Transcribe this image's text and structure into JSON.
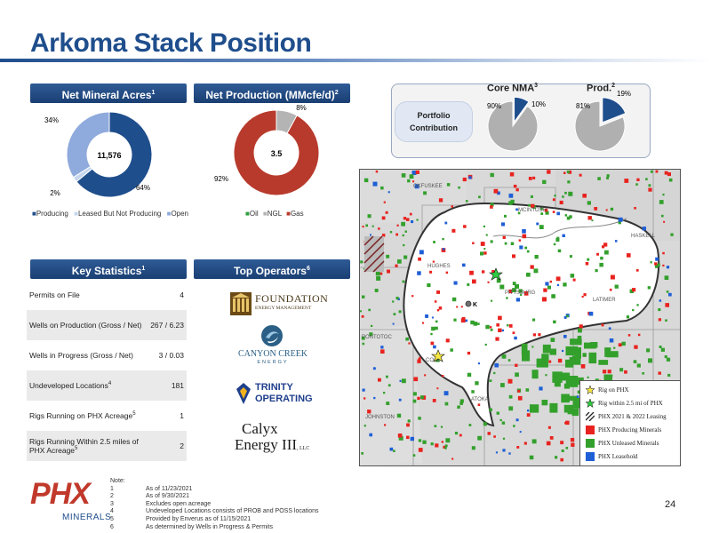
{
  "page": {
    "title": "Arkoma Stack Position",
    "page_number": "24"
  },
  "colors": {
    "brand_blue": "#1f4e8c",
    "producing": "#1f4e8c",
    "leased_not_producing": "#c5d6ee",
    "open": "#8faadc",
    "oil": "#2e9e3e",
    "ngl": "#b4b4b4",
    "gas": "#b83a2c",
    "pie_gray": "#b0b0b0",
    "phx_red": "#c0392b"
  },
  "net_mineral_acres": {
    "header": "Net Mineral Acres",
    "header_sup": "1",
    "center_value": "11,576",
    "labels": {
      "open_pct": "34%",
      "leased_pct": "2%",
      "producing_pct": "64%"
    },
    "legend": [
      "Producing",
      "Leased But Not Producing",
      "Open"
    ]
  },
  "net_production": {
    "header": "Net Production (MMcfe/d)",
    "header_sup": "2",
    "center_value": "3.5",
    "labels": {
      "ngl_pct": "8%",
      "gas_pct": "92%"
    },
    "legend": [
      "Oil",
      "NGL",
      "Gas"
    ]
  },
  "chart_data": [
    {
      "type": "pie",
      "title": "Net Mineral Acres",
      "categories": [
        "Producing",
        "Leased But Not Producing",
        "Open"
      ],
      "values": [
        64,
        2,
        34
      ],
      "center_label": "11,576"
    },
    {
      "type": "pie",
      "title": "Net Production (MMcfe/d)",
      "categories": [
        "Oil",
        "NGL",
        "Gas"
      ],
      "values": [
        0,
        8,
        92
      ],
      "center_label": "3.5"
    },
    {
      "type": "pie",
      "title": "Core NMA",
      "categories": [
        "Core NMA",
        "Other"
      ],
      "values": [
        10,
        90
      ]
    },
    {
      "type": "pie",
      "title": "Prod.",
      "categories": [
        "Prod.",
        "Other"
      ],
      "values": [
        19,
        81
      ]
    }
  ],
  "portfolio": {
    "label_line1": "Portfolio",
    "label_line2": "Contribution",
    "core_title": "Core NMA",
    "core_sup": "3",
    "core_small": "10%",
    "core_large": "90%",
    "prod_title": "Prod.",
    "prod_sup": "2",
    "prod_small": "19%",
    "prod_large": "81%"
  },
  "key_statistics": {
    "header": "Key Statistics",
    "header_sup": "1",
    "rows": [
      {
        "label": "Permits on File",
        "sup": "",
        "value": "4"
      },
      {
        "label": "Wells on Production (Gross / Net)",
        "sup": "",
        "value": "267 / 6.23"
      },
      {
        "label": "Wells in Progress  (Gross / Net)",
        "sup": "",
        "value": "3 / 0.03"
      },
      {
        "label": "Undeveloped Locations",
        "sup": "4",
        "value": "181"
      },
      {
        "label": "Rigs Running on PHX Acreage",
        "sup": "5",
        "value": "1"
      },
      {
        "label": "Rigs Running Within 2.5 miles of PHX Acreage",
        "sup": "5",
        "value": "2"
      }
    ]
  },
  "top_operators": {
    "header": "Top Operators",
    "header_sup": "6",
    "foundation_main": "FOUNDATION",
    "foundation_sub": "ENERGY MANAGEMENT",
    "canyon_main": "CANYON CREEK",
    "canyon_sub": "ENERGY",
    "trinity_line1": "TRINITY",
    "trinity_line2": "OPERATING",
    "calyx_line1": "Calyx",
    "calyx_line2": "Energy III",
    "calyx_suffix": ", LLC"
  },
  "map": {
    "counties": [
      "MCINTOSH",
      "HASKELL",
      "HUGHES",
      "PITTSBURG",
      "COAL",
      "ATOKA",
      "JOHNSTON",
      "OKFUSKEE",
      "PONTOTOC",
      "LATIMER"
    ],
    "marker_label": "K",
    "legend": [
      {
        "label": "Rig on PHX",
        "color": "#f5e642"
      },
      {
        "label": "Rig within 2.5 mi of PHX",
        "color": "#2ecc40"
      },
      {
        "label": "PHX 2021 & 2022 Leasing",
        "color": "hatch"
      },
      {
        "label": "PHX Producing Minerals",
        "color": "#e8231f"
      },
      {
        "label": "PHX Unleased Minerals",
        "color": "#33a02c"
      },
      {
        "label": "PHX Leasehold",
        "color": "#1f5fd6"
      }
    ]
  },
  "notes": {
    "heading": "Note:",
    "items": [
      {
        "num": "1",
        "text": "As of 11/23/2021"
      },
      {
        "num": "2",
        "text": "As of 9/30/2021"
      },
      {
        "num": "3",
        "text": "Excludes open acreage"
      },
      {
        "num": "4",
        "text": "Undeveloped Locations consists of PROB and POSS locations"
      },
      {
        "num": "5",
        "text": "Provided by Enverus as of 11/15/2021"
      },
      {
        "num": "6",
        "text": "As determined by Wells in Progress & Permits"
      }
    ]
  },
  "logo": {
    "text": "PHX",
    "sub": "MINERALS"
  }
}
